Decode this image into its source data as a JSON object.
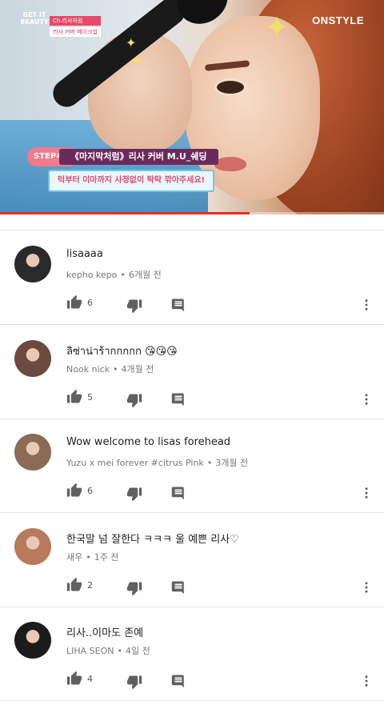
{
  "video": {
    "logo_left": "GET IT BEAUTY",
    "tag_top": "Ch.리사처럼",
    "tag_bottom": "리사 커버 메이크업",
    "brand": "ONSTYLE",
    "step_label": "STEP#3",
    "caption": "《마지막처럼》리사 커버 M.U_쉐딩",
    "subcaption": "턱부터 이마까지 사정없이 탁탁 깎아주세요!",
    "progress": 0.65
  },
  "comments": [
    {
      "author": "kepho kepo",
      "time": "6개월 전",
      "text": "lisaaaa",
      "likes": "6",
      "avatar_color": "#2a2a2a"
    },
    {
      "author": "Nook nick",
      "time": "4개월 전",
      "text": "ลิซ่าน่าร้ากกกกก 😘😘😘",
      "likes": "5",
      "avatar_color": "#6b4a3f"
    },
    {
      "author": "Yuzu x mei forever #citrus Pink",
      "time": "3개월 전",
      "text": "Wow welcome to lisas forehead",
      "likes": "6",
      "avatar_color": "#8a6b55"
    },
    {
      "author": "새우",
      "time": "1주 전",
      "text": "한국말 넘 잘한다 ㅋㅋㅋ 울 예쁜 리사♡",
      "likes": "2",
      "avatar_color": "#b87a5c"
    },
    {
      "author": "LIHA SEON",
      "time": "4일 전",
      "text": "리사..이마도 존예",
      "likes": "4",
      "avatar_color": "#1c1c1c"
    }
  ],
  "icons": {
    "like": "thumb-up-icon",
    "dislike": "thumb-down-icon",
    "reply": "reply-comment-icon",
    "more": "more-vertical-icon"
  },
  "colors": {
    "progress": "#e52d27",
    "text": "#212121",
    "meta": "#777777"
  }
}
